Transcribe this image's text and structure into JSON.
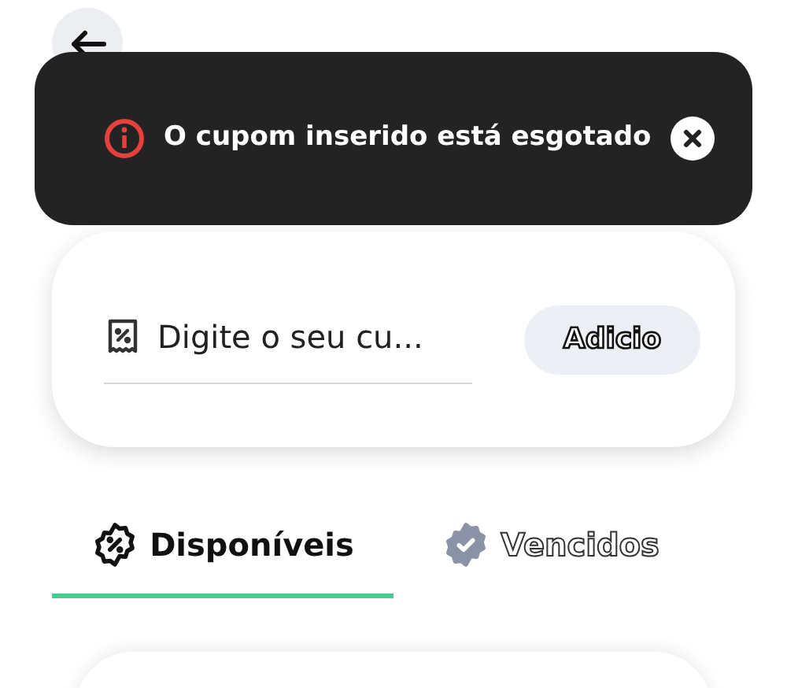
{
  "toast": {
    "message": "O cupom inserido está esgotado"
  },
  "coupon_input": {
    "placeholder": "Digite o seu cu...",
    "button": "Adicio"
  },
  "tabs": [
    {
      "label": "Disponíveis",
      "selected": true
    },
    {
      "label": "Vencidos",
      "selected": false
    }
  ]
}
